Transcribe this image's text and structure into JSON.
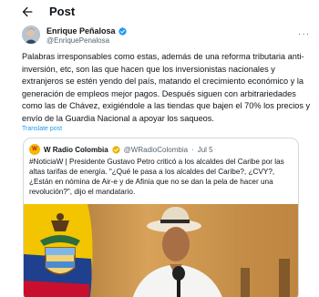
{
  "header": {
    "title": "Post"
  },
  "author": {
    "name": "Enrique Peñalosa",
    "handle": "@EnriquePenalosa"
  },
  "post": {
    "text": "Palabras irresponsables como estas, además de una reforma tributaria anti-inversión, etc, son las que hacen que los inversionistas nacionales y extranjeros se estén yendo del país, matando el crecimiento económico y la generación de empleos mejor pagos. Después siguen con arbitrariedades como las de Chávez, exigiéndole a las tiendas que bajen el 70% los precios y envío de la Guardia Nacional a apoyar los saqueos.",
    "translate_label": "Translate post"
  },
  "quote": {
    "avatar_text": "W",
    "name": "W Radio Colombia",
    "handle": "@WRadioColombia",
    "separator": "·",
    "date": "Jul 5",
    "text": "#NoticiaW | Presidente Gustavo Petro criticó a los alcaldes del Caribe por las altas tarifas de energía. \"¿Qué le pasa a los alcaldes del Caribe?, ¿CVY?, ¿Están en nómina de Air-e y de Afinia que no se dan la pela de hacer una revolución?\", dijo el mandatario."
  },
  "colors": {
    "accent": "#1d9bf0",
    "muted": "#536471",
    "text": "#0f1419",
    "border": "#cfd9de"
  },
  "icons": [
    "back-arrow-icon",
    "verified-badge-icon",
    "more-icon"
  ]
}
